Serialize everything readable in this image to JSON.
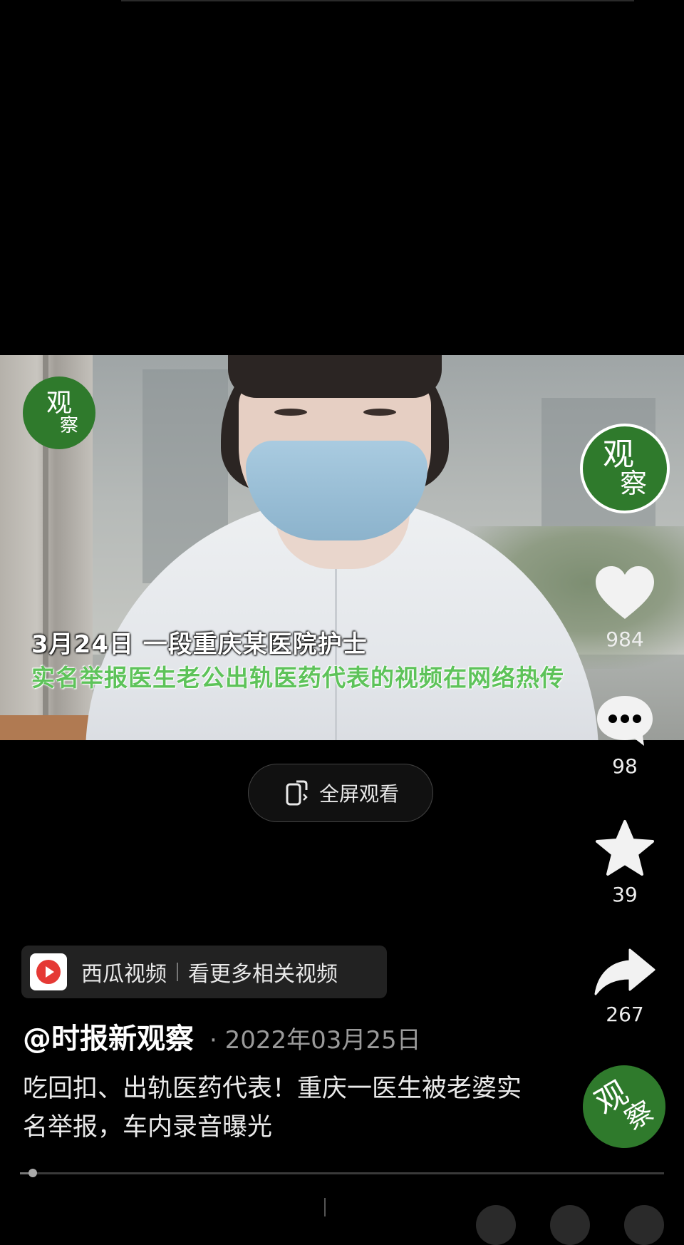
{
  "video": {
    "watermark_logo": {
      "big": "观",
      "small": "察"
    },
    "subtitle_line1": "3月24日  一段重庆某医院护士",
    "subtitle_line2": "实名举报医生老公出轨医药代表的视频在网络热传"
  },
  "fullscreen_button": {
    "label": "全屏观看",
    "icon": "rotate-phone-icon"
  },
  "rail": {
    "avatar_top": {
      "big": "观",
      "small": "察"
    },
    "like": {
      "icon": "heart-icon",
      "count": "984"
    },
    "comment": {
      "icon": "comment-bubble-icon",
      "count": "98"
    },
    "favorite": {
      "icon": "star-icon",
      "count": "39"
    },
    "share": {
      "icon": "share-arrow-icon",
      "count": "267"
    },
    "avatar_bottom": {
      "big": "观",
      "small": "察"
    }
  },
  "xigua": {
    "icon": "xigua-video-logo-icon",
    "app_name": "西瓜视频",
    "link_text": "看更多相关视频"
  },
  "post": {
    "author": "@时报新观察",
    "date": "· 2022年03月25日",
    "description": "吃回扣、出轨医药代表！重庆一医生被老婆实名举报，车内录音曝光"
  },
  "progress": {
    "fraction": 0.02
  },
  "colors": {
    "accent_green": "#2f7a2c",
    "subtitle_green": "#5ec35a",
    "xigua_red": "#e53935"
  }
}
